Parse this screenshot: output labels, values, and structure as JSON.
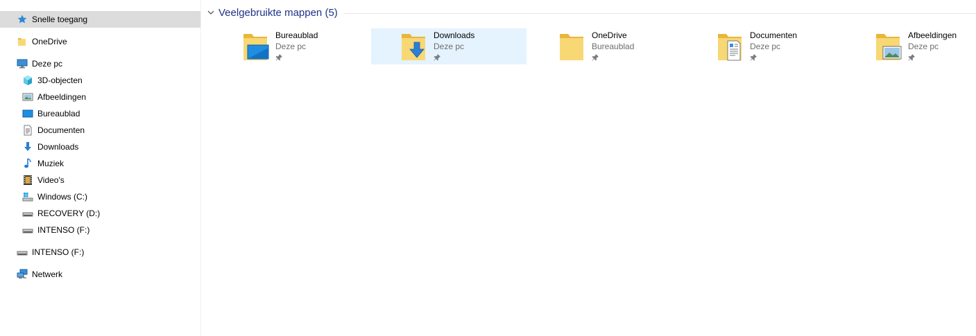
{
  "nav": {
    "quick_access": "Snelle toegang",
    "onedrive": "OneDrive",
    "this_pc": "Deze pc",
    "pc_items": [
      {
        "label": "3D-objecten",
        "icon": "3d-objects-icon"
      },
      {
        "label": "Afbeeldingen",
        "icon": "pictures-icon"
      },
      {
        "label": "Bureaublad",
        "icon": "desktop-icon"
      },
      {
        "label": "Documenten",
        "icon": "documents-icon"
      },
      {
        "label": "Downloads",
        "icon": "downloads-icon"
      },
      {
        "label": "Muziek",
        "icon": "music-icon"
      },
      {
        "label": "Video's",
        "icon": "videos-icon"
      },
      {
        "label": "Windows (C:)",
        "icon": "windows-drive-icon"
      },
      {
        "label": "RECOVERY (D:)",
        "icon": "drive-icon"
      },
      {
        "label": "INTENSO (F:)",
        "icon": "drive-icon"
      }
    ],
    "intenso": "INTENSO (F:)",
    "network": "Netwerk"
  },
  "content": {
    "group_title": "Veelgebruikte mappen (5)",
    "folders": [
      {
        "name": "Bureaublad",
        "location": "Deze pc",
        "icon": "desktop-folder-icon"
      },
      {
        "name": "Downloads",
        "location": "Deze pc",
        "icon": "downloads-folder-icon"
      },
      {
        "name": "OneDrive",
        "location": "Bureaublad",
        "icon": "folder-icon"
      },
      {
        "name": "Documenten",
        "location": "Deze pc",
        "icon": "documents-folder-icon"
      },
      {
        "name": "Afbeeldingen",
        "location": "Deze pc",
        "icon": "pictures-folder-icon"
      }
    ]
  },
  "colors": {
    "selected_bg": "#dcdcdc",
    "hover_bg": "#e5f3ff",
    "group_title": "#1e3287",
    "secondary_text": "#6d6d6d",
    "folder_yellow": "#f8d775"
  }
}
